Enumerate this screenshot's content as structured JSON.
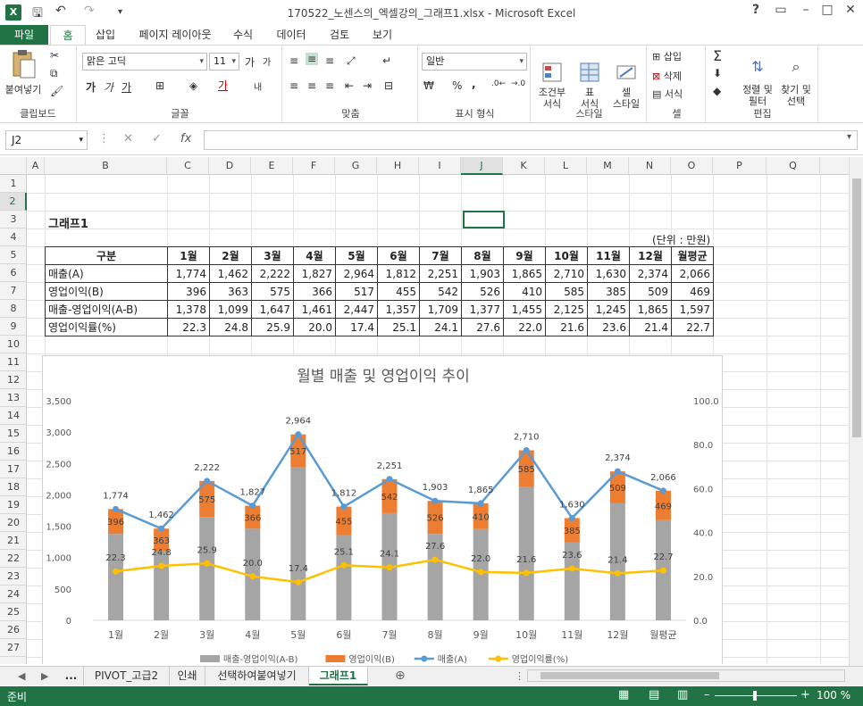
{
  "window": {
    "title": "170522_노센스의_엑셀강의_그래프1.xlsx - Microsoft Excel",
    "logo": "X",
    "controls": [
      "?",
      "▭",
      "–",
      "□",
      "✕"
    ]
  },
  "quick_access": [
    "save-icon",
    "undo-icon",
    "redo-icon",
    "customize-icon"
  ],
  "ribbon_tabs": [
    "파일",
    "홈",
    "삽입",
    "페이지 레이아웃",
    "수식",
    "데이터",
    "검토",
    "보기"
  ],
  "ribbon": {
    "clipboard": {
      "paste": "붙여넣기",
      "label": "클립보드"
    },
    "font": {
      "name": "맑은 고딕",
      "size": "11",
      "label": "글꼴",
      "bold": "가",
      "italic": "가",
      "underline": "가"
    },
    "alignment": {
      "label": "맞춤"
    },
    "number": {
      "format": "일반",
      "label": "표시 형식",
      "percent": "%",
      "comma": ","
    },
    "styles": {
      "conditional": "조건부\n서식",
      "table": "표\n서식",
      "cell": "셀\n스타일",
      "label": "스타일"
    },
    "cells": {
      "insert": "삽입",
      "delete": "삭제",
      "format": "서식",
      "label": "셀"
    },
    "editing": {
      "sort": "정렬 및\n필터",
      "find": "찾기 및\n선택",
      "label": "편집"
    }
  },
  "formula_bar": {
    "name_box": "J2",
    "fx": "fx",
    "value": ""
  },
  "columns": [
    "A",
    "B",
    "C",
    "D",
    "E",
    "F",
    "G",
    "H",
    "I",
    "J",
    "K",
    "L",
    "M",
    "N",
    "O",
    "P",
    "Q"
  ],
  "selected_column": "J",
  "rows": [
    "1",
    "2",
    "3",
    "4",
    "5",
    "6",
    "7",
    "8",
    "9",
    "10",
    "11",
    "12",
    "13",
    "14",
    "15",
    "16",
    "17",
    "18",
    "19",
    "20",
    "21",
    "22",
    "23",
    "24",
    "25",
    "26",
    "27"
  ],
  "selected_row": "2",
  "sheet": {
    "title": "그래프1",
    "unit": "(단위 : 만원)",
    "table": {
      "headers": [
        "구분",
        "1월",
        "2월",
        "3월",
        "4월",
        "5월",
        "6월",
        "7월",
        "8월",
        "9월",
        "10월",
        "11월",
        "12월",
        "월평균"
      ],
      "rows": [
        {
          "label": "매출(A)",
          "values": [
            "1,774",
            "1,462",
            "2,222",
            "1,827",
            "2,964",
            "1,812",
            "2,251",
            "1,903",
            "1,865",
            "2,710",
            "1,630",
            "2,374",
            "2,066"
          ]
        },
        {
          "label": "영업이익(B)",
          "values": [
            "396",
            "363",
            "575",
            "366",
            "517",
            "455",
            "542",
            "526",
            "410",
            "585",
            "385",
            "509",
            "469"
          ]
        },
        {
          "label": "매출-영업이익(A-B)",
          "values": [
            "1,378",
            "1,099",
            "1,647",
            "1,461",
            "2,447",
            "1,357",
            "1,709",
            "1,377",
            "1,455",
            "2,125",
            "1,245",
            "1,865",
            "1,597"
          ]
        },
        {
          "label": "영업이익률(%)",
          "values": [
            "22.3",
            "24.8",
            "25.9",
            "20.0",
            "17.4",
            "25.1",
            "24.1",
            "27.6",
            "22.0",
            "21.6",
            "23.6",
            "21.4",
            "22.7"
          ]
        }
      ]
    }
  },
  "chart_data": {
    "type": "bar",
    "title": "월별 매출 및 영업이익 추이",
    "categories": [
      "1월",
      "2월",
      "3월",
      "4월",
      "5월",
      "6월",
      "7월",
      "8월",
      "9월",
      "10월",
      "11월",
      "12월",
      "월평균"
    ],
    "series": [
      {
        "name": "매출-영업이익(A-B)",
        "kind": "stacked-bar",
        "axis": "primary",
        "color": "#A5A5A5",
        "values": [
          1378,
          1099,
          1647,
          1461,
          2447,
          1357,
          1709,
          1377,
          1455,
          2125,
          1245,
          1865,
          1597
        ]
      },
      {
        "name": "영업이익(B)",
        "kind": "stacked-bar",
        "axis": "primary",
        "color": "#ED7D31",
        "values": [
          396,
          363,
          575,
          366,
          517,
          455,
          542,
          526,
          410,
          585,
          385,
          509,
          469
        ]
      },
      {
        "name": "매출(A)",
        "kind": "line",
        "axis": "primary",
        "color": "#5B9BD5",
        "values": [
          1774,
          1462,
          2222,
          1827,
          2964,
          1812,
          2251,
          1903,
          1865,
          2710,
          1630,
          2374,
          2066
        ]
      },
      {
        "name": "영업이익률(%)",
        "kind": "line",
        "axis": "secondary",
        "color": "#FFC000",
        "values": [
          22.3,
          24.8,
          25.9,
          20.0,
          17.4,
          25.1,
          24.1,
          27.6,
          22.0,
          21.6,
          23.6,
          21.4,
          22.7
        ]
      }
    ],
    "ylim": [
      0,
      3500
    ],
    "yticks": [
      "0",
      "500",
      "1,000",
      "1,500",
      "2,000",
      "2,500",
      "3,000",
      "3,500"
    ],
    "ylim2": [
      0,
      100
    ],
    "yticks2": [
      "0.0",
      "20.0",
      "40.0",
      "60.0",
      "80.0",
      "100.0"
    ],
    "legend_position": "bottom",
    "grid": false
  },
  "sheet_tabs": [
    "...",
    "PIVOT_고급2",
    "인쇄",
    "선택하여붙여넣기",
    "그래프1"
  ],
  "active_sheet": "그래프1",
  "status": {
    "ready": "준비",
    "zoom": "100 %"
  }
}
